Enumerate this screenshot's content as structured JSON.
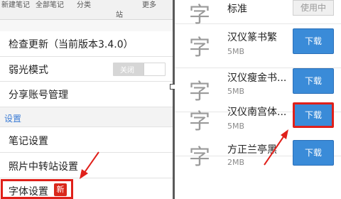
{
  "left_panel": {
    "top_tabs": [
      {
        "label": "新建笔记"
      },
      {
        "label": "全部笔记"
      },
      {
        "label": "分类"
      },
      {
        "label": "站"
      },
      {
        "label": "更多"
      }
    ],
    "check_update": "检查更新（当前版本3.4.0）",
    "night_mode": {
      "label": "弱光模式",
      "toggle_state": "关闭"
    },
    "share_accounts": "分享账号管理",
    "section_title": "设置",
    "note_settings": "笔记设置",
    "photo_transfer": "照片中转站设置",
    "font_settings": "字体设置",
    "new_badge": "新"
  },
  "fonts": [
    {
      "glyph": "字",
      "name": "标准",
      "action": "使用中"
    },
    {
      "glyph": "字",
      "name": "汉仪篆书繁",
      "size": "5MB",
      "action": "下载"
    },
    {
      "glyph": "字",
      "name": "汉仪瘦金书...",
      "size": "5MB",
      "action": "下载"
    },
    {
      "glyph": "字",
      "name": "汉仪南宫体...",
      "size": "5MB",
      "action": "下载"
    },
    {
      "glyph": "字",
      "name": "方正兰亭黑",
      "size": "2MB",
      "action": "下载"
    }
  ],
  "colors": {
    "accent": "#3a8bd8",
    "highlight": "#e0201a",
    "badge": "#d9281c"
  }
}
